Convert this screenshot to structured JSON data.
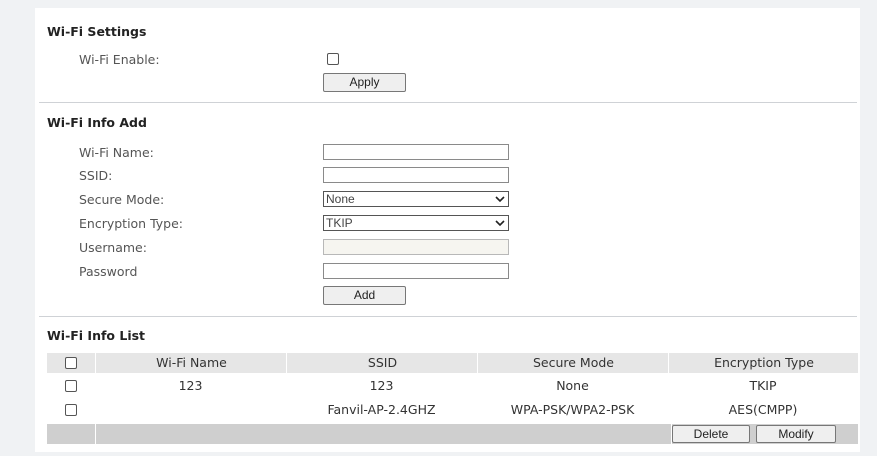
{
  "wifi_settings": {
    "title": "Wi-Fi Settings",
    "enable_label": "Wi-Fi Enable:",
    "apply_label": "Apply"
  },
  "wifi_info_add": {
    "title": "Wi-Fi Info Add",
    "name_label": "Wi-Fi Name:",
    "ssid_label": "SSID:",
    "secure_mode_label": "Secure Mode:",
    "secure_mode_value": "None",
    "encryption_type_label": "Encryption Type:",
    "encryption_type_value": "TKIP",
    "username_label": "Username:",
    "password_label": "Password",
    "add_label": "Add"
  },
  "wifi_info_list": {
    "title": "Wi-Fi Info List",
    "columns": [
      "Wi-Fi Name",
      "SSID",
      "Secure Mode",
      "Encryption Type"
    ],
    "rows": [
      {
        "name": "123",
        "ssid": "123",
        "secure_mode": "None",
        "encryption": "TKIP"
      },
      {
        "name": "",
        "ssid": "Fanvil-AP-2.4GHZ",
        "secure_mode": "WPA-PSK/WPA2-PSK",
        "encryption": "AES(CMPP)"
      }
    ],
    "delete_label": "Delete",
    "modify_label": "Modify"
  }
}
